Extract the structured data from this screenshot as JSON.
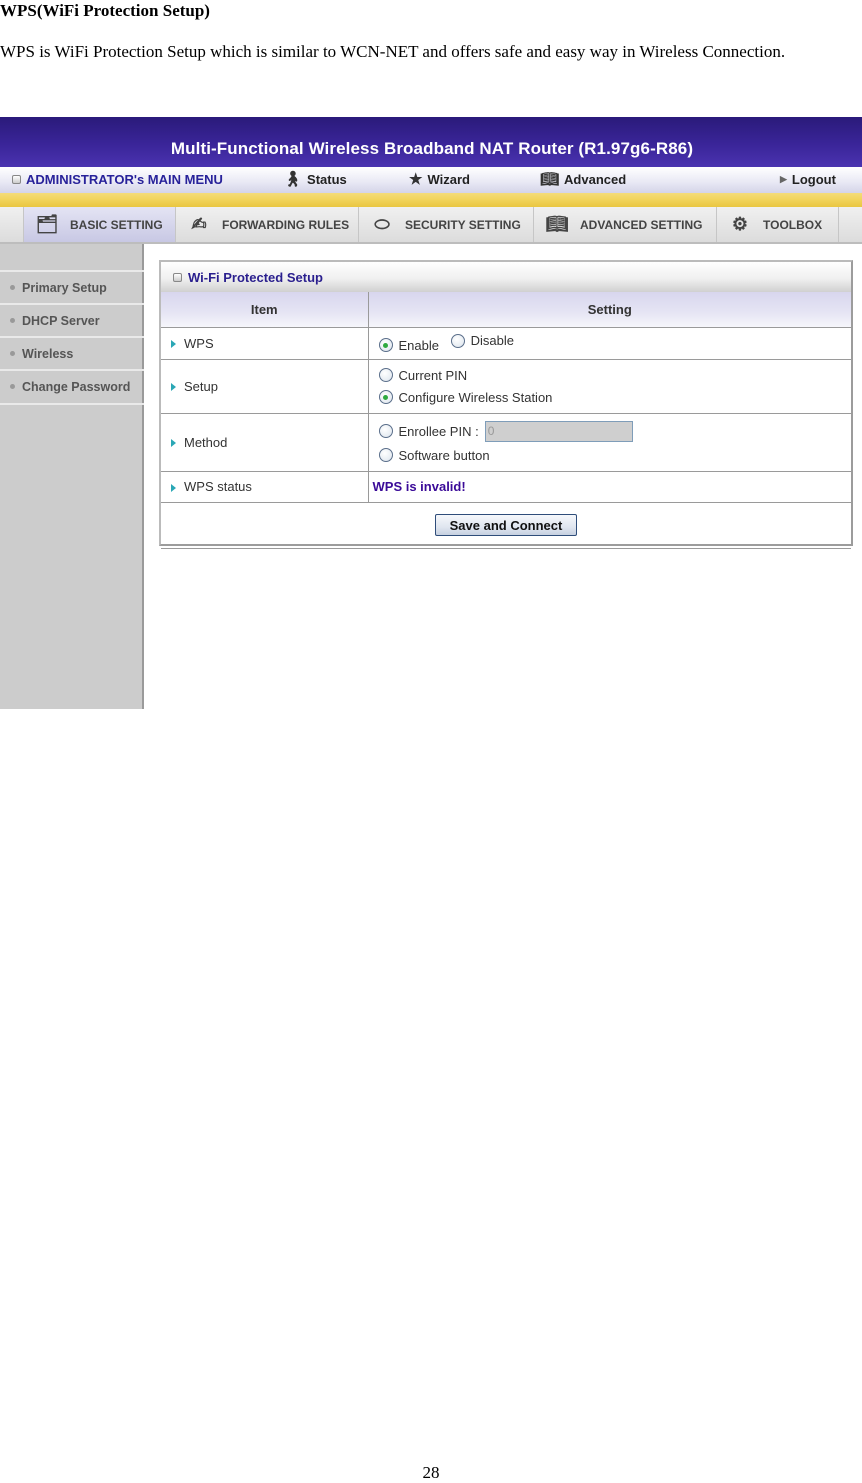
{
  "document": {
    "heading": "WPS(WiFi Protection Setup)",
    "paragraph": "WPS is WiFi Protection Setup which is similar to WCN-NET and offers safe and easy way in Wireless Connection.",
    "page_number": "28"
  },
  "router": {
    "banner_title": "Multi-Functional Wireless Broadband NAT Router (R1.97g6-R86)",
    "menu": {
      "admin_label": "ADMINISTRATOR's MAIN MENU",
      "items": [
        {
          "label": "Status",
          "icon": "status-person-icon"
        },
        {
          "label": "Wizard",
          "icon": "wizard-icon"
        },
        {
          "label": "Advanced",
          "icon": "advanced-book-icon"
        },
        {
          "label": "Logout",
          "icon": "triangle-right-icon"
        }
      ]
    },
    "tabs": [
      {
        "label": "BASIC SETTING",
        "icon": "folder-document-icon",
        "active": true
      },
      {
        "label": "FORWARDING RULES",
        "icon": "forwarding-icon",
        "active": false
      },
      {
        "label": "SECURITY SETTING",
        "icon": "security-nut-icon",
        "active": false
      },
      {
        "label": "ADVANCED SETTING",
        "icon": "advanced-book-icon",
        "active": false
      },
      {
        "label": "TOOLBOX",
        "icon": "toolbox-gear-icon",
        "active": false
      }
    ],
    "sidebar": {
      "items": [
        {
          "label": "Primary Setup"
        },
        {
          "label": "DHCP Server"
        },
        {
          "label": "Wireless"
        },
        {
          "label": "Change Password"
        }
      ]
    },
    "panel": {
      "title": "Wi-Fi Protected Setup",
      "columns": {
        "item": "Item",
        "setting": "Setting"
      },
      "rows": {
        "wps": {
          "label": "WPS",
          "options": [
            {
              "label": "Enable",
              "selected": true
            },
            {
              "label": "Disable",
              "selected": false
            }
          ]
        },
        "setup": {
          "label": "Setup",
          "options": [
            {
              "label": "Current PIN",
              "selected": false
            },
            {
              "label": "Configure Wireless Station",
              "selected": true
            }
          ]
        },
        "method": {
          "label": "Method",
          "options": [
            {
              "label": "Enrollee PIN :",
              "selected": false
            },
            {
              "label": "Software button",
              "selected": false
            }
          ],
          "pin_value": "0"
        },
        "status": {
          "label": "WPS status",
          "value": "WPS is invalid!"
        }
      },
      "save_button": "Save and Connect"
    },
    "colors": {
      "banner": "#3a2599",
      "gold_bar": "#f1d35a",
      "status_text": "#3a0a98",
      "radio_selected": "#2faa3f",
      "row_marker": "#2aa7b5"
    }
  }
}
